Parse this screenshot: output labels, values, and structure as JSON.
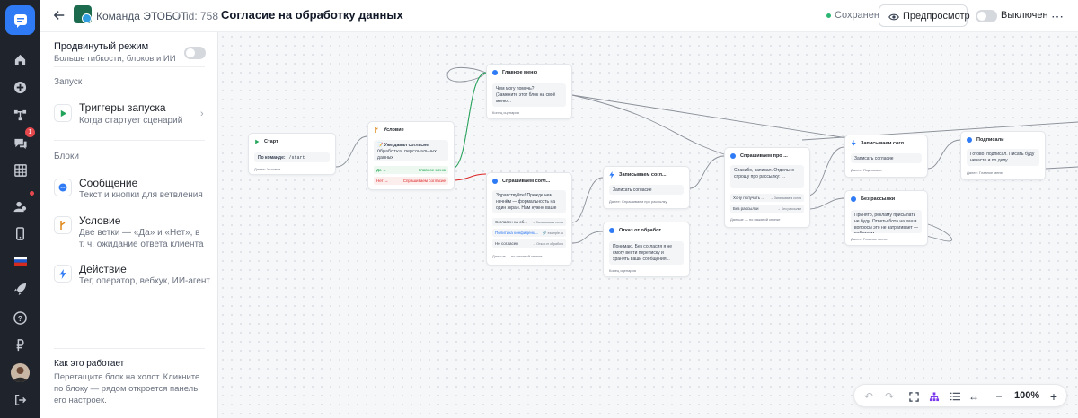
{
  "app": {
    "workspace": "Команда ЭТОБОТ",
    "separator": "/",
    "id_label": "id: 758",
    "title": "Согласие на обработку данных",
    "saved_status": "Сохранено",
    "preview_label": "Предпросмотр",
    "toggle_label": "Выключен"
  },
  "rail": {
    "notification_count": "1",
    "icons": [
      "home-icon",
      "plus-circle-icon",
      "flow-icon",
      "chat-icon",
      "grid-icon",
      "users-icon",
      "phone-icon",
      "flag-ru-icon",
      "rocket-icon",
      "help-icon",
      "ruble-icon",
      "avatar",
      "logout-icon"
    ]
  },
  "sidebar": {
    "advanced_title": "Продвинутый режим",
    "advanced_sub": "Больше гибкости, блоков и ИИ",
    "launch_section": "Запуск",
    "triggers_title": "Триггеры запуска",
    "triggers_sub": "Когда стартует сценарий",
    "blocks_section": "Блоки",
    "blocks": [
      {
        "title": "Сообщение",
        "sub": "Текст и кнопки для ветвления"
      },
      {
        "title": "Условие",
        "sub": "Две ветки — «Да» и «Нет», в т. ч. ожидание ответа клиента"
      },
      {
        "title": "Действие",
        "sub": "Тег, оператор, вебхук, ИИ-агент"
      }
    ],
    "how_title": "Как это работает",
    "how_text": "Перетащите блок на холст. Кликните по блоку — рядом откроется панель его настроек."
  },
  "canvas": {
    "start": {
      "title": "Старт",
      "cmd_label": "По команде:",
      "cmd": "/start",
      "foot": "Далее: Условие"
    },
    "condition": {
      "title": "Условие",
      "body": "📝 Уже давал согласие",
      "body2": "Обработка персональных данных",
      "yes": "Да →",
      "yes_target": "Главное меню",
      "no": "Нет →",
      "no_target": "Спрашиваем согласие"
    },
    "main_menu": {
      "title": "Главное меню",
      "q": "Чем могу помочь?",
      "body": "(Замените этот блок на своё меню...",
      "foot": "Конец сценария"
    },
    "ask_consent": {
      "title": "Спрашиваем согл...",
      "body": "Здравствуйте! Прежде чем начнём — формальность на один экран. Нам нужно ваше согласие...",
      "r1": "Согласен на об...",
      "r1t": "→ Записываем согла",
      "r2": "Политика конфиденц...",
      "r2t": "🔗 example.ru",
      "r3": "Не согласен",
      "r3t": "→ Отказ от обработк",
      "foot": "Дальше — по нажатой кнопке"
    },
    "write_consent": {
      "title": "Записываем согл...",
      "body": "Записать согласие",
      "foot": "Далее: Спрашиваем про рассылку"
    },
    "refuse": {
      "title": "Отказ от обработ...",
      "body": "Понимаю. Без согласия я не смогу вести переписку и хранить ваши сообщения...",
      "foot": "Конец сценария"
    },
    "ask_mailing": {
      "title": "Спрашиваем про ...",
      "body": "Спасибо, записал. Отдельно спрошу про рассылку: ...",
      "r1": "Хочу получать ...",
      "r1t": "→ Записываем согла",
      "r2": "Без рассылки",
      "r2t": "→ Без рассылки",
      "foot": "Дальше — по нажатой кнопке"
    },
    "write_consent2": {
      "title": "Записываем согл...",
      "body": "Записать согласие",
      "foot": "Далее: Подписали"
    },
    "no_mailing": {
      "title": "Без рассылки",
      "body": "Принято, рекламу присылать не буду. Ответы бота на ваши вопросы это не затрагивает — работаем ...",
      "foot": "Далее: Главное меню"
    },
    "subscribed": {
      "title": "Подписали",
      "body": "Готово, подписал. Писать буду нечасто и по делу.",
      "foot": "Далее: Главное меню"
    }
  },
  "zoom": {
    "level": "100%"
  },
  "colors": {
    "accent": "#2f7bf5",
    "rail_bg": "#1f232b",
    "saved": "#2bb673",
    "yes_green": "#16a34a",
    "no_red": "#dc2626"
  }
}
